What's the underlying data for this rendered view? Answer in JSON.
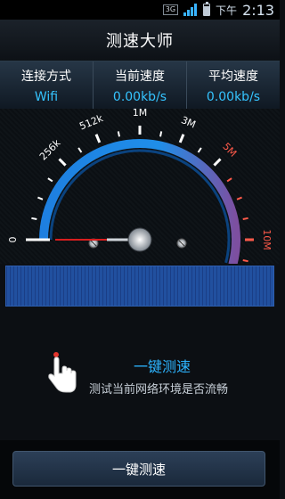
{
  "status_bar": {
    "network": "3G",
    "ampm": "下午",
    "time": "2:13"
  },
  "header": {
    "title": "测速大师"
  },
  "stats": [
    {
      "label": "连接方式",
      "value": "Wifi"
    },
    {
      "label": "当前速度",
      "value": "0.00kb/s"
    },
    {
      "label": "平均速度",
      "value": "0.00kb/s"
    }
  ],
  "gauge": {
    "ticks": [
      "0",
      "256k",
      "512k",
      "1M",
      "3M",
      "5M",
      "10M"
    ],
    "needle_value": "0",
    "colors": {
      "blue": "#1e7fe0",
      "accent": "#ff5a4a",
      "purple": "#7d4fa0"
    }
  },
  "hint": {
    "title": "一键测速",
    "subtitle": "测试当前网络环境是否流畅"
  },
  "button": {
    "label": "一键测速"
  }
}
